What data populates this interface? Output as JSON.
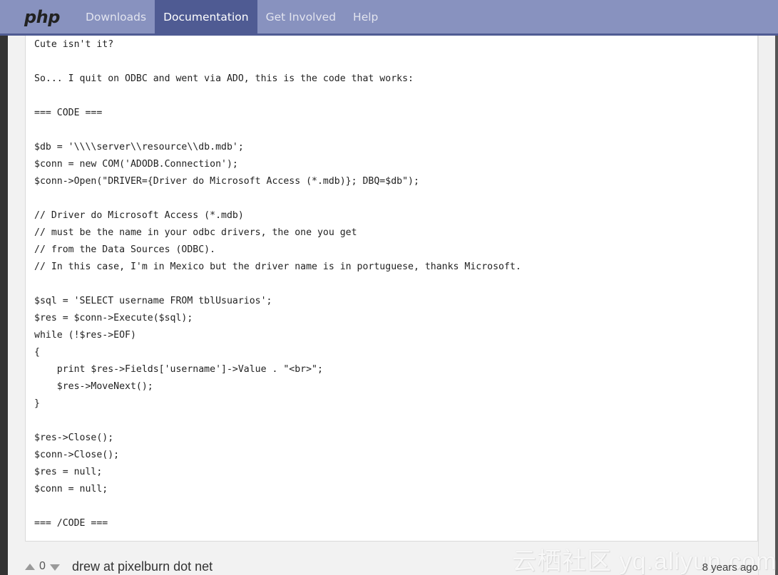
{
  "navbar": {
    "logo": "php",
    "items": [
      {
        "label": "Downloads",
        "active": false
      },
      {
        "label": "Documentation",
        "active": true
      },
      {
        "label": "Get Involved",
        "active": false
      },
      {
        "label": "Help",
        "active": false
      }
    ]
  },
  "note": {
    "code_lines": [
      "Cute isn't it?",
      "",
      "So... I quit on ODBC and went via ADO, this is the code that works:",
      "",
      "=== CODE ===",
      "",
      "$db = '\\\\\\\\server\\\\resource\\\\db.mdb';",
      "$conn = new COM('ADODB.Connection');",
      "$conn->Open(\"DRIVER={Driver do Microsoft Access (*.mdb)}; DBQ=$db\");",
      "",
      "// Driver do Microsoft Access (*.mdb)",
      "// must be the name in your odbc drivers, the one you get",
      "// from the Data Sources (ODBC).",
      "// In this case, I'm in Mexico but the driver name is in portuguese, thanks Microsoft.",
      "",
      "$sql = 'SELECT username FROM tblUsuarios';",
      "$res = $conn->Execute($sql);",
      "while (!$res->EOF)",
      "{",
      "    print $res->Fields['username']->Value . \"<br>\";",
      "    $res->MoveNext();",
      "}",
      "",
      "$res->Close();",
      "$conn->Close();",
      "$res = null;",
      "$conn = null;",
      "",
      "=== /CODE ==="
    ]
  },
  "next_note": {
    "vote_up_icon": "triangle-up",
    "vote_count": "0",
    "vote_down_icon": "triangle-down",
    "author": "drew at pixelburn dot net",
    "date": "8 years ago"
  },
  "watermark": "云栖社区 yq.aliyun.com"
}
